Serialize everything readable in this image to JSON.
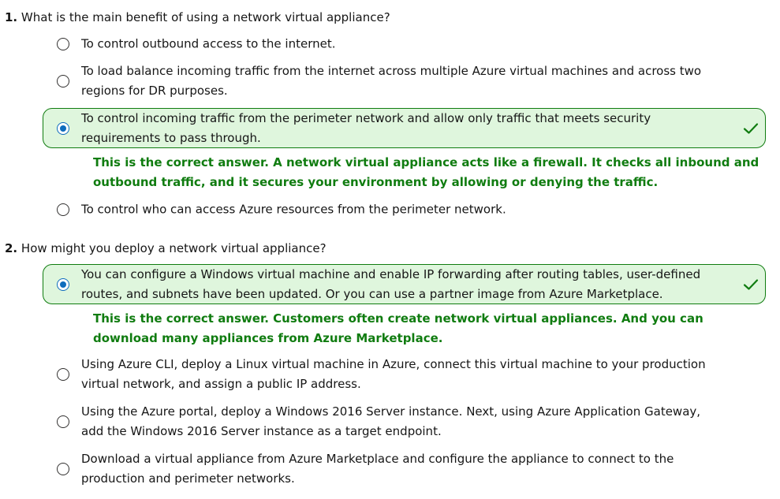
{
  "questions": [
    {
      "number": "1.",
      "text": "What is the main benefit of using a network virtual appliance?",
      "options": [
        {
          "label": "To control outbound access to the internet.",
          "selected": false
        },
        {
          "label": "To load balance incoming traffic from the internet across multiple Azure virtual machines and across two regions for DR purposes.",
          "selected": false
        },
        {
          "label": "To control incoming traffic from the perimeter network and allow only traffic that meets security requirements to pass through.",
          "selected": true,
          "correct": true
        },
        {
          "label": "To control who can access Azure resources from the perimeter network.",
          "selected": false
        }
      ],
      "explanation": "This is the correct answer. A network virtual appliance acts like a firewall. It checks all inbound and outbound traffic, and it secures your environment by allowing or denying the traffic."
    },
    {
      "number": "2.",
      "text": "How might you deploy a network virtual appliance?",
      "options": [
        {
          "label": "You can configure a Windows virtual machine and enable IP forwarding after routing tables, user-defined routes, and subnets have been updated. Or you can use a partner image from Azure Marketplace.",
          "selected": true,
          "correct": true
        },
        {
          "label": "Using Azure CLI, deploy a Linux virtual machine in Azure, connect this virtual machine to your production virtual network, and assign a public IP address.",
          "selected": false
        },
        {
          "label": "Using the Azure portal, deploy a Windows 2016 Server instance. Next, using Azure Application Gateway, add the Windows 2016 Server instance as a target endpoint.",
          "selected": false
        },
        {
          "label": "Download a virtual appliance from Azure Marketplace and configure the appliance to connect to the production and perimeter networks.",
          "selected": false
        }
      ],
      "explanation": "This is the correct answer. Customers often create network virtual appliances. And you can download many appliances from Azure Marketplace."
    }
  ],
  "colors": {
    "correct_green": "#107c10",
    "selected_bg": "#dff6dd",
    "radio_selected": "#0f6cbd"
  },
  "icons": {
    "correct": "checkmark-icon",
    "option": "radio-icon"
  }
}
